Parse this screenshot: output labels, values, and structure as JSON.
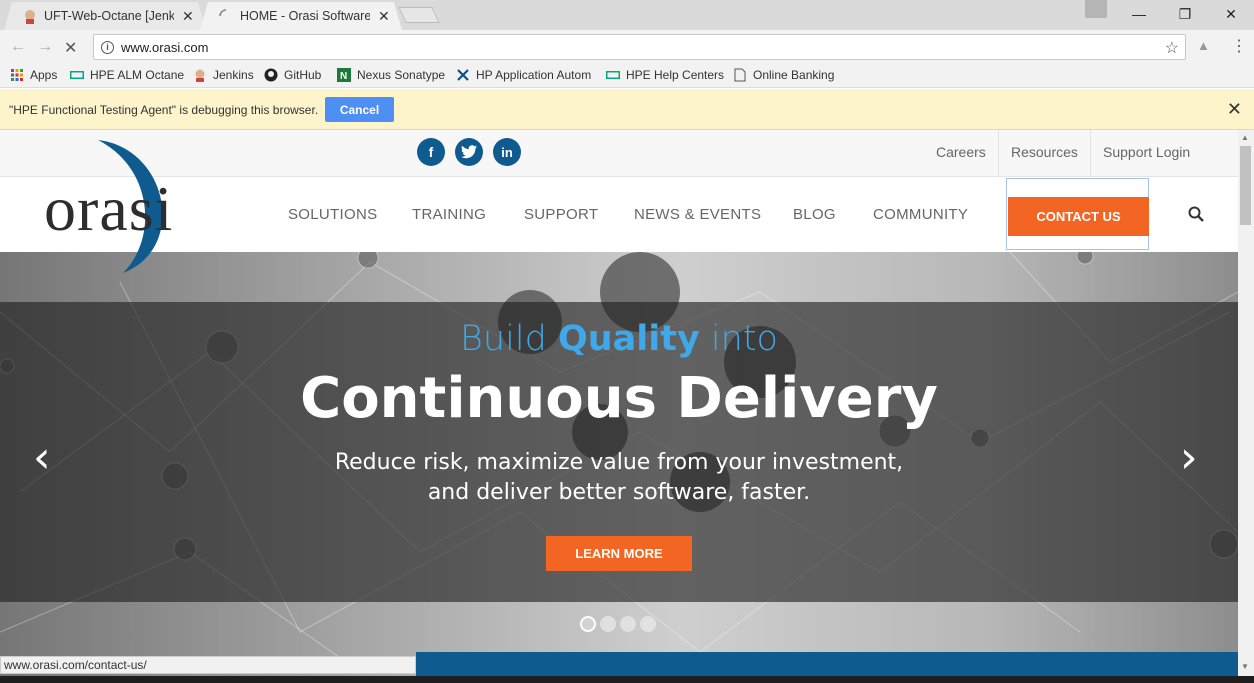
{
  "browser": {
    "tabs": [
      {
        "title": "UFT-Web-Octane [Jenkin"
      },
      {
        "title": "HOME - Orasi Software, I"
      }
    ],
    "url": "www.orasi.com",
    "bookmarks": [
      {
        "label": "Apps",
        "icon": "apps-grid-icon"
      },
      {
        "label": "HPE ALM Octane",
        "icon": "hpe-icon"
      },
      {
        "label": "Jenkins",
        "icon": "jenkins-icon"
      },
      {
        "label": "GitHub",
        "icon": "github-icon"
      },
      {
        "label": "Nexus Sonatype",
        "icon": "nexus-icon"
      },
      {
        "label": "HP Application Autom",
        "icon": "hp-tools-icon"
      },
      {
        "label": "HPE Help Centers",
        "icon": "hpe-icon"
      },
      {
        "label": "Online Banking",
        "icon": "page-icon"
      }
    ],
    "debug_bar": {
      "message": "\"HPE Functional Testing Agent\" is debugging this browser.",
      "cancel_label": "Cancel"
    },
    "status_url": "www.orasi.com/contact-us/"
  },
  "site": {
    "social": [
      "f",
      "t",
      "in"
    ],
    "top_links": [
      "Careers",
      "Resources",
      "Support Login"
    ],
    "logo_text": "orasi",
    "nav": [
      "SOLUTIONS",
      "TRAINING",
      "SUPPORT",
      "NEWS & EVENTS",
      "BLOG",
      "COMMUNITY"
    ],
    "contact_label": "CONTACT US",
    "hero": {
      "kicker_pre": "Build ",
      "kicker_bold": "Quality",
      "kicker_post": " into",
      "title": "Continuous Delivery",
      "sub_line1": "Reduce risk, maximize value from your investment,",
      "sub_line2": "and deliver better software, faster.",
      "cta": "LEARN MORE"
    },
    "slides": {
      "count": 4,
      "active": 1
    }
  },
  "colors": {
    "accent_orange": "#f26522",
    "brand_blue": "#0f5a8f",
    "kicker_blue": "#3ea8e8",
    "chrome_blue": "#4d8ff2"
  }
}
